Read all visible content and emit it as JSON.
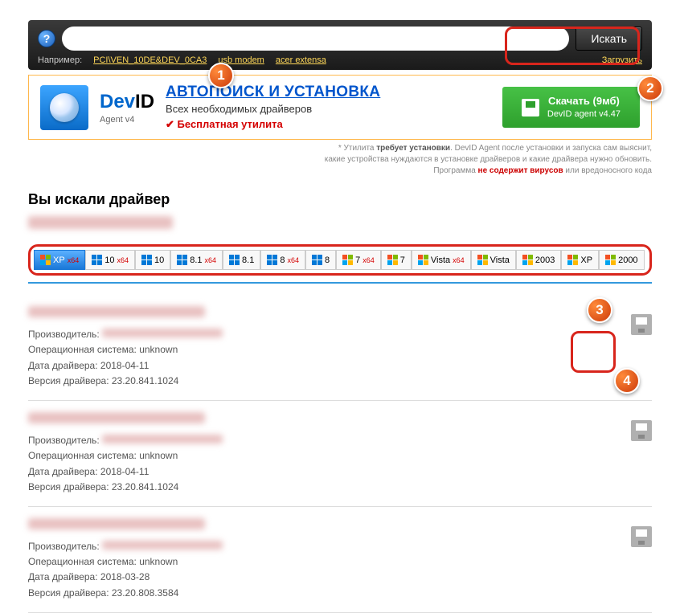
{
  "topbar": {
    "help": "?",
    "search_value": "",
    "search_placeholder": "",
    "btn": "Искать",
    "example_label": "Например:",
    "links": [
      "PCI\\VEN_10DE&DEV_0CA3",
      "usb modem",
      "acer extensa"
    ],
    "upload": "Загрузить"
  },
  "promo": {
    "brand_a": "Dev",
    "brand_b": "ID",
    "agent": "Agent v4",
    "headline": "АВТОПОИСК И УСТАНОВКА",
    "desc": "Всех необходимых драйверов",
    "free": "Бесплатная утилита",
    "download": "Скачать (9мб)",
    "download_sub": "DevID agent v4.47"
  },
  "disclaimer": {
    "l1a": "* Утилита ",
    "l1b": "требует установки",
    "l1c": ". DevID Agent после установки и запуска сам выяснит,",
    "l2": "какие устройства нуждаются в установке драйверов и какие драйвера нужно обновить.",
    "l3a": "Программа ",
    "l3b": "не содержит вирусов",
    "l3c": " или вредоносного кода"
  },
  "section_title": "Вы искали драйвер",
  "os_tabs": [
    {
      "label": "XP",
      "x64": true,
      "old": true,
      "active": true
    },
    {
      "label": "10",
      "x64": true,
      "old": false
    },
    {
      "label": "10",
      "x64": false,
      "old": false
    },
    {
      "label": "8.1",
      "x64": true,
      "old": false
    },
    {
      "label": "8.1",
      "x64": false,
      "old": false
    },
    {
      "label": "8",
      "x64": true,
      "old": false
    },
    {
      "label": "8",
      "x64": false,
      "old": false
    },
    {
      "label": "7",
      "x64": true,
      "old": true
    },
    {
      "label": "7",
      "x64": false,
      "old": true
    },
    {
      "label": "Vista",
      "x64": true,
      "old": true
    },
    {
      "label": "Vista",
      "x64": false,
      "old": true
    },
    {
      "label": "2003",
      "x64": false,
      "old": true
    },
    {
      "label": "XP",
      "x64": false,
      "old": true
    },
    {
      "label": "2000",
      "x64": false,
      "old": true
    }
  ],
  "labels": {
    "manufacturer": "Производитель: ",
    "os": "Операционная система: ",
    "date": "Дата драйвера: ",
    "version": "Версия драйвера: "
  },
  "results": [
    {
      "os": "unknown",
      "date": "2018-04-11",
      "version": "23.20.841.1024"
    },
    {
      "os": "unknown",
      "date": "2018-04-11",
      "version": "23.20.841.1024"
    },
    {
      "os": "unknown",
      "date": "2018-03-28",
      "version": "23.20.808.3584"
    }
  ],
  "markers": {
    "m1": "1",
    "m2": "2",
    "m3": "3",
    "m4": "4"
  }
}
